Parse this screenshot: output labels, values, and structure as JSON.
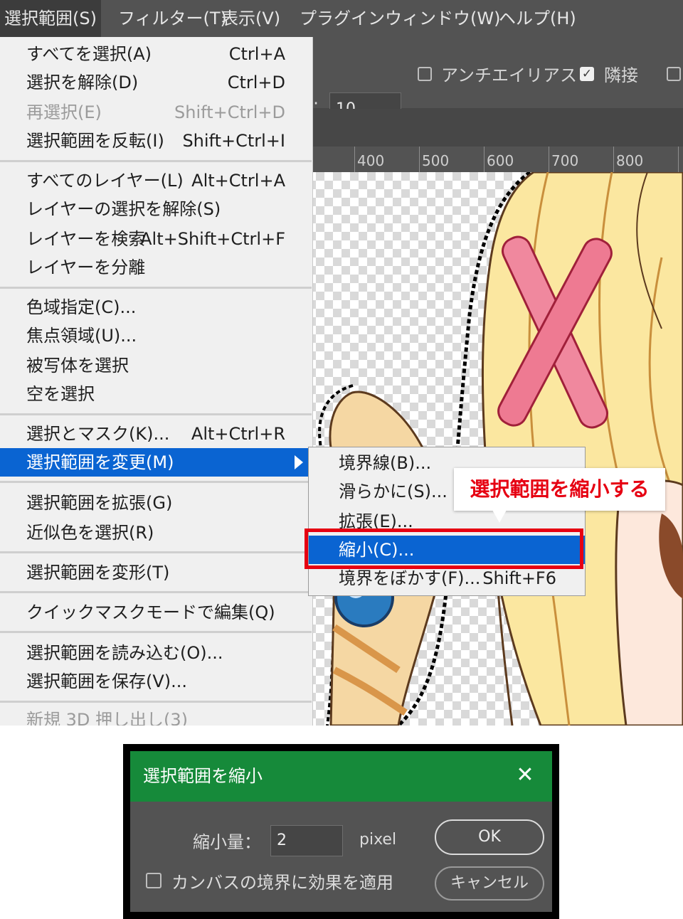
{
  "menubar": {
    "items": [
      "選択範囲(S)",
      "フィルター(T)",
      "表示(V)",
      "プラグイン",
      "ウィンドウ(W)",
      "ヘルプ(H)"
    ]
  },
  "options": {
    "tolerance_value": "10",
    "antialias_label": "アンチエイリアス",
    "antialias_checked": false,
    "contiguous_label": "隣接",
    "contiguous_checked": true
  },
  "ruler": {
    "labels": [
      "400",
      "500",
      "600",
      "700",
      "800"
    ]
  },
  "menu": {
    "items": [
      {
        "label": "すべてを選択(A)",
        "shortcut": "Ctrl+A"
      },
      {
        "label": "選択を解除(D)",
        "shortcut": "Ctrl+D"
      },
      {
        "label": "再選択(E)",
        "shortcut": "Shift+Ctrl+D",
        "disabled": true
      },
      {
        "label": "選択範囲を反転(I)",
        "shortcut": "Shift+Ctrl+I"
      },
      {
        "label": "すべてのレイヤー(L)",
        "shortcut": "Alt+Ctrl+A"
      },
      {
        "label": "レイヤーの選択を解除(S)",
        "shortcut": ""
      },
      {
        "label": "レイヤーを検索",
        "shortcut": "Alt+Shift+Ctrl+F"
      },
      {
        "label": "レイヤーを分離",
        "shortcut": ""
      },
      {
        "label": "色域指定(C)...",
        "shortcut": ""
      },
      {
        "label": "焦点領域(U)...",
        "shortcut": ""
      },
      {
        "label": "被写体を選択",
        "shortcut": ""
      },
      {
        "label": "空を選択",
        "shortcut": ""
      },
      {
        "label": "選択とマスク(K)...",
        "shortcut": "Alt+Ctrl+R"
      },
      {
        "label": "選択範囲を変更(M)",
        "shortcut": "",
        "highlighted": true
      },
      {
        "label": "選択範囲を拡張(G)",
        "shortcut": ""
      },
      {
        "label": "近似色を選択(R)",
        "shortcut": ""
      },
      {
        "label": "選択範囲を変形(T)",
        "shortcut": ""
      },
      {
        "label": "クイックマスクモードで編集(Q)",
        "shortcut": ""
      },
      {
        "label": "選択範囲を読み込む(O)...",
        "shortcut": ""
      },
      {
        "label": "選択範囲を保存(V)...",
        "shortcut": ""
      },
      {
        "label": "新規 3D 押し出し(3)",
        "shortcut": "",
        "disabled": true
      }
    ]
  },
  "submenu": {
    "items": [
      {
        "label": "境界線(B)...",
        "shortcut": ""
      },
      {
        "label": "滑らかに(S)...",
        "shortcut": ""
      },
      {
        "label": "拡張(E)...",
        "shortcut": ""
      },
      {
        "label": "縮小(C)...",
        "shortcut": "",
        "highlighted": true
      },
      {
        "label": "境界をぼかす(F)...",
        "shortcut": "Shift+F6"
      }
    ]
  },
  "callout": {
    "text": "選択範囲を縮小する"
  },
  "dialog": {
    "title": "選択範囲を縮小",
    "close_glyph": "✕",
    "amount_label": "縮小量：",
    "amount_value": "2",
    "unit": "pixel",
    "ok_label": "OK",
    "cancel_label": "キャンセル",
    "canvas_bounds_label": "カンバスの境界に効果を適用",
    "canvas_bounds_checked": false
  },
  "colors": {
    "highlight": "#0a64d2",
    "annotation_red": "#e60012",
    "dialog_title_green": "#168a3a"
  }
}
